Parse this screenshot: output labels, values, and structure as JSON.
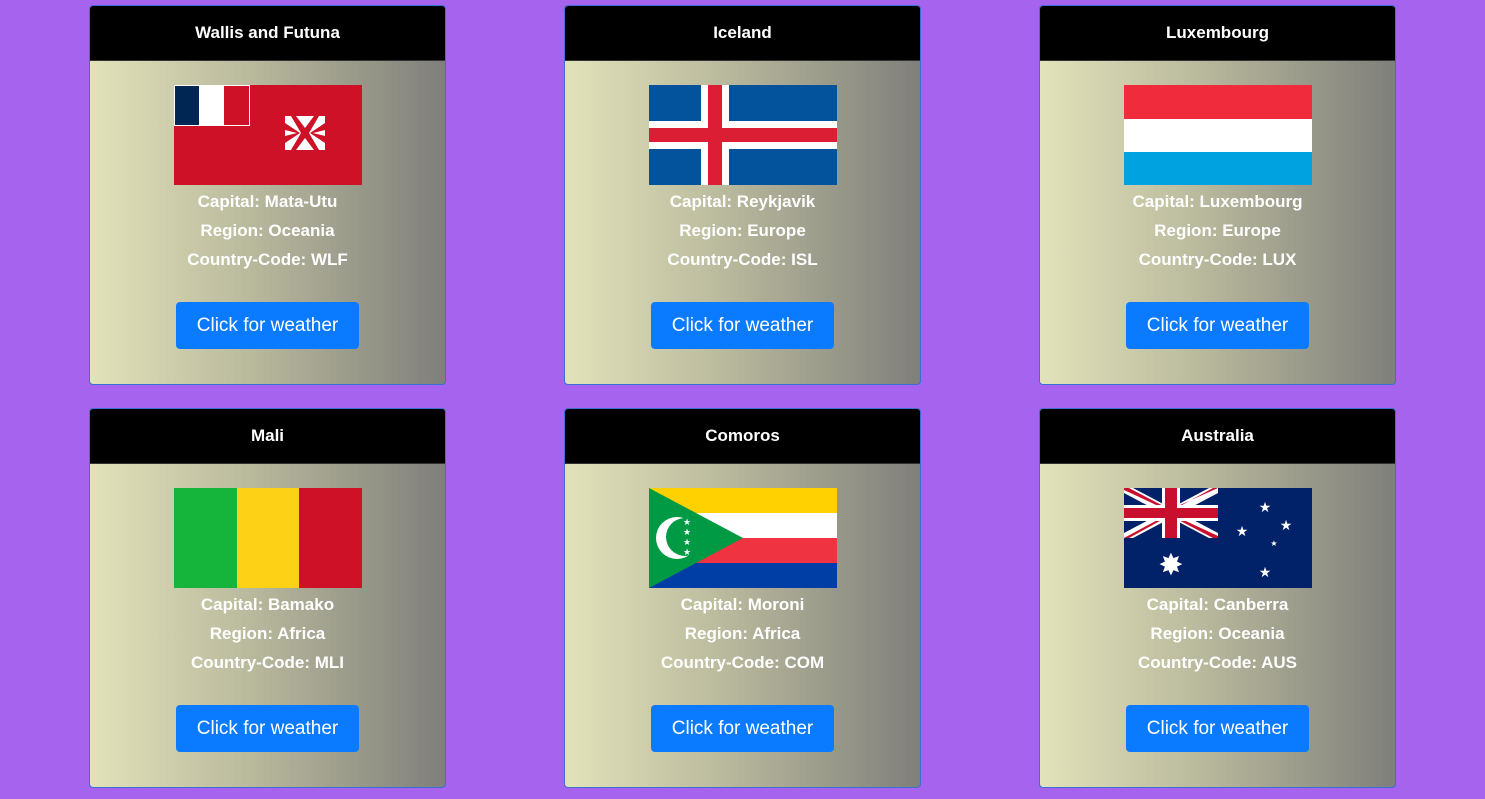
{
  "cards": [
    {
      "name": "Wallis and Futuna",
      "capital": "Capital: Mata-Utu",
      "region": "Region: Oceania",
      "code": "Country-Code: WLF",
      "button_label": "Click for weather",
      "flag_icon": "wallis-and-futuna-flag-icon"
    },
    {
      "name": "Iceland",
      "capital": "Capital: Reykjavik",
      "region": "Region: Europe",
      "code": "Country-Code: ISL",
      "button_label": "Click for weather",
      "flag_icon": "iceland-flag-icon"
    },
    {
      "name": "Luxembourg",
      "capital": "Capital: Luxembourg",
      "region": "Region: Europe",
      "code": "Country-Code: LUX",
      "button_label": "Click for weather",
      "flag_icon": "luxembourg-flag-icon"
    },
    {
      "name": "Mali",
      "capital": "Capital: Bamako",
      "region": "Region: Africa",
      "code": "Country-Code: MLI",
      "button_label": "Click for weather",
      "flag_icon": "mali-flag-icon"
    },
    {
      "name": "Comoros",
      "capital": "Capital: Moroni",
      "region": "Region: Africa",
      "code": "Country-Code: COM",
      "button_label": "Click for weather",
      "flag_icon": "comoros-flag-icon"
    },
    {
      "name": "Australia",
      "capital": "Capital: Canberra",
      "region": "Region: Oceania",
      "code": "Country-Code: AUS",
      "button_label": "Click for weather",
      "flag_icon": "australia-flag-icon"
    }
  ],
  "colors": {
    "page_background": "#a663ee",
    "header_background": "#000000",
    "button_background": "#0a7bff",
    "text": "#ffffff"
  }
}
